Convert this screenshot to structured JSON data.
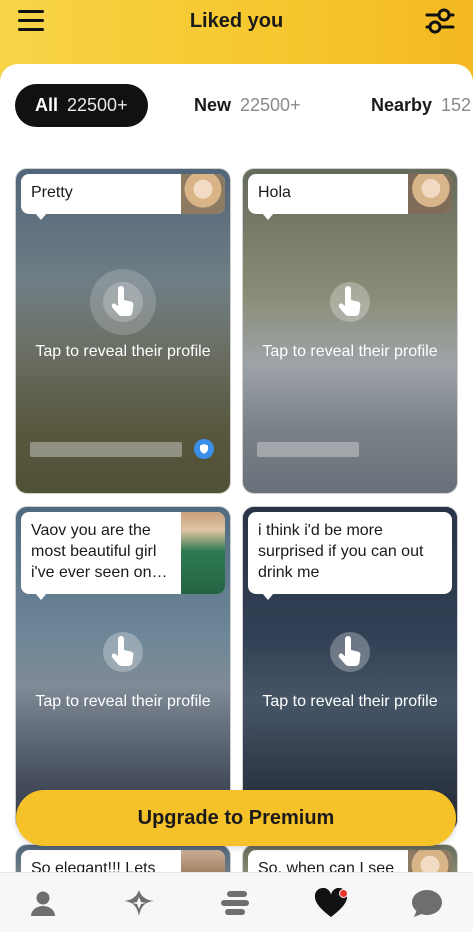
{
  "header": {
    "title": "Liked you",
    "menu_icon": "hamburger-menu-icon",
    "filter_icon": "sliders-filter-icon",
    "gradient_colors": [
      "#f7d448",
      "#f4b822"
    ]
  },
  "filters": [
    {
      "label": "All",
      "count": "22500+",
      "selected": true
    },
    {
      "label": "New",
      "count": "22500+",
      "selected": false
    },
    {
      "label": "Nearby",
      "count": "152",
      "selected": false
    }
  ],
  "cards": [
    {
      "message": "Pretty",
      "tap_text": "Tap to reveal their profile",
      "verified": true
    },
    {
      "message": "Hola",
      "tap_text": "Tap to reveal their profile",
      "verified": false
    },
    {
      "message": "Vaov you are the most beautiful girl i've ever seen on…",
      "tap_text": "Tap to reveal their profile",
      "verified": true
    },
    {
      "message": "i think i'd be more surprised if you can out drink me",
      "tap_text": "Tap to reveal their profile",
      "verified": true
    }
  ],
  "partial_cards": [
    {
      "message": "So elegant!!! Lets"
    },
    {
      "message": "So, when can I see"
    }
  ],
  "upgrade": {
    "label": "Upgrade to Premium",
    "color": "#f6c229"
  },
  "bottom_nav": [
    {
      "icon": "profile-icon",
      "active": false
    },
    {
      "icon": "premium-diamond-icon",
      "active": false
    },
    {
      "icon": "discover-stack-icon",
      "active": false
    },
    {
      "icon": "liked-you-heart-icon",
      "active": true,
      "notification_dot": true
    },
    {
      "icon": "chat-bubble-icon",
      "active": false
    }
  ]
}
